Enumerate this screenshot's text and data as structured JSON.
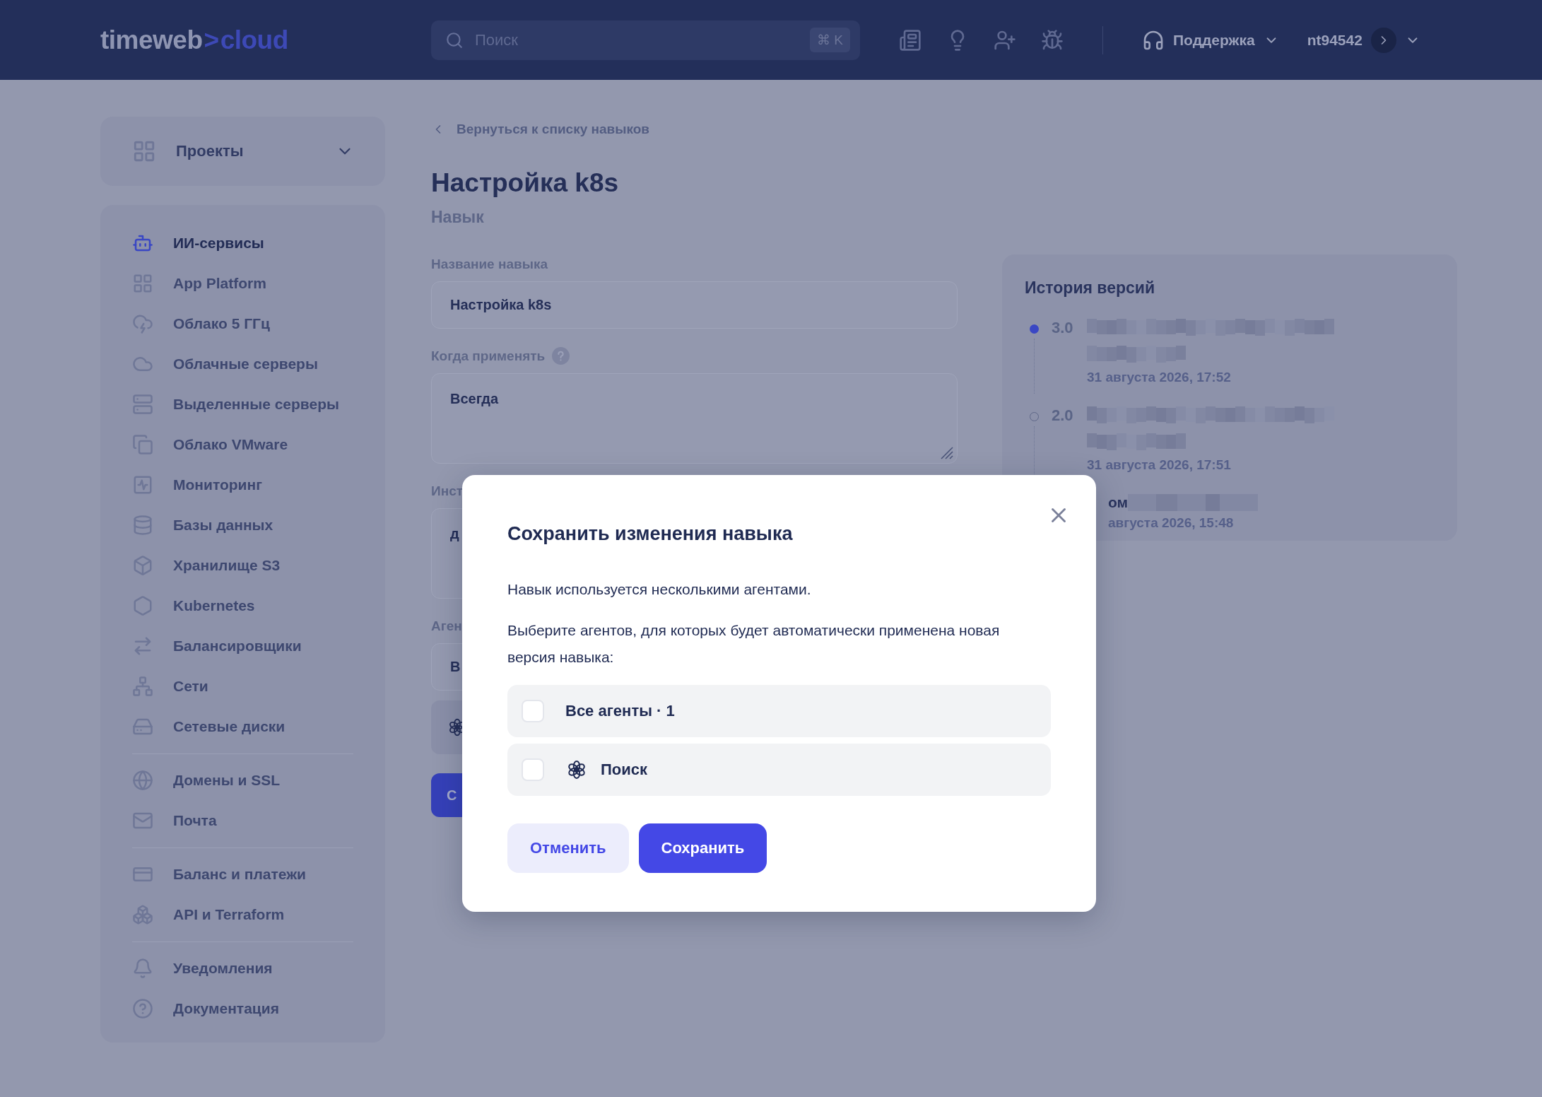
{
  "header": {
    "logo": {
      "name": "timeweb",
      "separator": ">",
      "product": "cloud"
    },
    "search": {
      "placeholder": "Поиск",
      "shortcut": "⌘ K"
    },
    "support": "Поддержка",
    "user": "nt94542"
  },
  "sidebar": {
    "projects": {
      "label": "Проекты",
      "expanded": false
    },
    "groups": [
      [
        {
          "label": "ИИ-сервисы",
          "selected": true
        },
        {
          "label": "App Platform",
          "selected": false
        },
        {
          "label": "Облако 5 ГГц",
          "selected": false
        },
        {
          "label": "Облачные серверы",
          "selected": false
        },
        {
          "label": "Выделенные серверы",
          "selected": false
        },
        {
          "label": "Облако VMware",
          "selected": false
        },
        {
          "label": "Мониторинг",
          "selected": false
        },
        {
          "label": "Базы данных",
          "selected": false
        },
        {
          "label": "Хранилище S3",
          "selected": false
        },
        {
          "label": "Kubernetes",
          "selected": false
        },
        {
          "label": "Балансировщики",
          "selected": false
        },
        {
          "label": "Сети",
          "selected": false
        },
        {
          "label": "Сетевые диски",
          "selected": false
        }
      ],
      [
        {
          "label": "Домены и SSL",
          "selected": false
        },
        {
          "label": "Почта",
          "selected": false
        }
      ],
      [
        {
          "label": "Баланс и платежи",
          "selected": false
        },
        {
          "label": "API и Terraform",
          "selected": false
        }
      ],
      [
        {
          "label": "Уведомления",
          "selected": false
        },
        {
          "label": "Документация",
          "selected": false
        }
      ]
    ]
  },
  "main": {
    "back_link": "Вернуться к списку навыков",
    "title": "Настройка k8s",
    "subtitle": "Навык",
    "fields": [
      {
        "kind": "input",
        "label": "Название навыка",
        "value": "Настройка k8s",
        "help": false
      },
      {
        "kind": "textarea",
        "label": "Когда применять",
        "value": "Всегда",
        "help": true,
        "resizable": true
      },
      {
        "kind": "textarea",
        "label": "Инст",
        "value": "д"
      },
      {
        "kind": "input",
        "label": "Аген",
        "value": "В"
      },
      {
        "kind": "agent"
      }
    ],
    "submit": "С"
  },
  "version_history": {
    "title": "История версий",
    "versions": [
      {
        "kind": "version",
        "version": "3.0",
        "selected": true,
        "date": "31 августа 2026, 17:52"
      },
      {
        "kind": "version",
        "version": "2.0",
        "selected": false,
        "date": "31 августа 2026, 17:51"
      },
      {
        "kind": "cut",
        "text": "ом",
        "date": "августа 2026, 15:48"
      }
    ]
  },
  "modal": {
    "title": "Сохранить изменения навыка",
    "paragraphs": [
      "Навык используется несколькими агентами.",
      "Выберите агентов, для которых будет автоматически применена новая версия навыка:"
    ],
    "options": [
      {
        "kind": "all",
        "label": "Все агенты · 1",
        "checked": false
      },
      {
        "kind": "agent",
        "label": "Поиск",
        "checked": false
      }
    ],
    "cancel": "Отменить",
    "save": "Сохранить"
  }
}
